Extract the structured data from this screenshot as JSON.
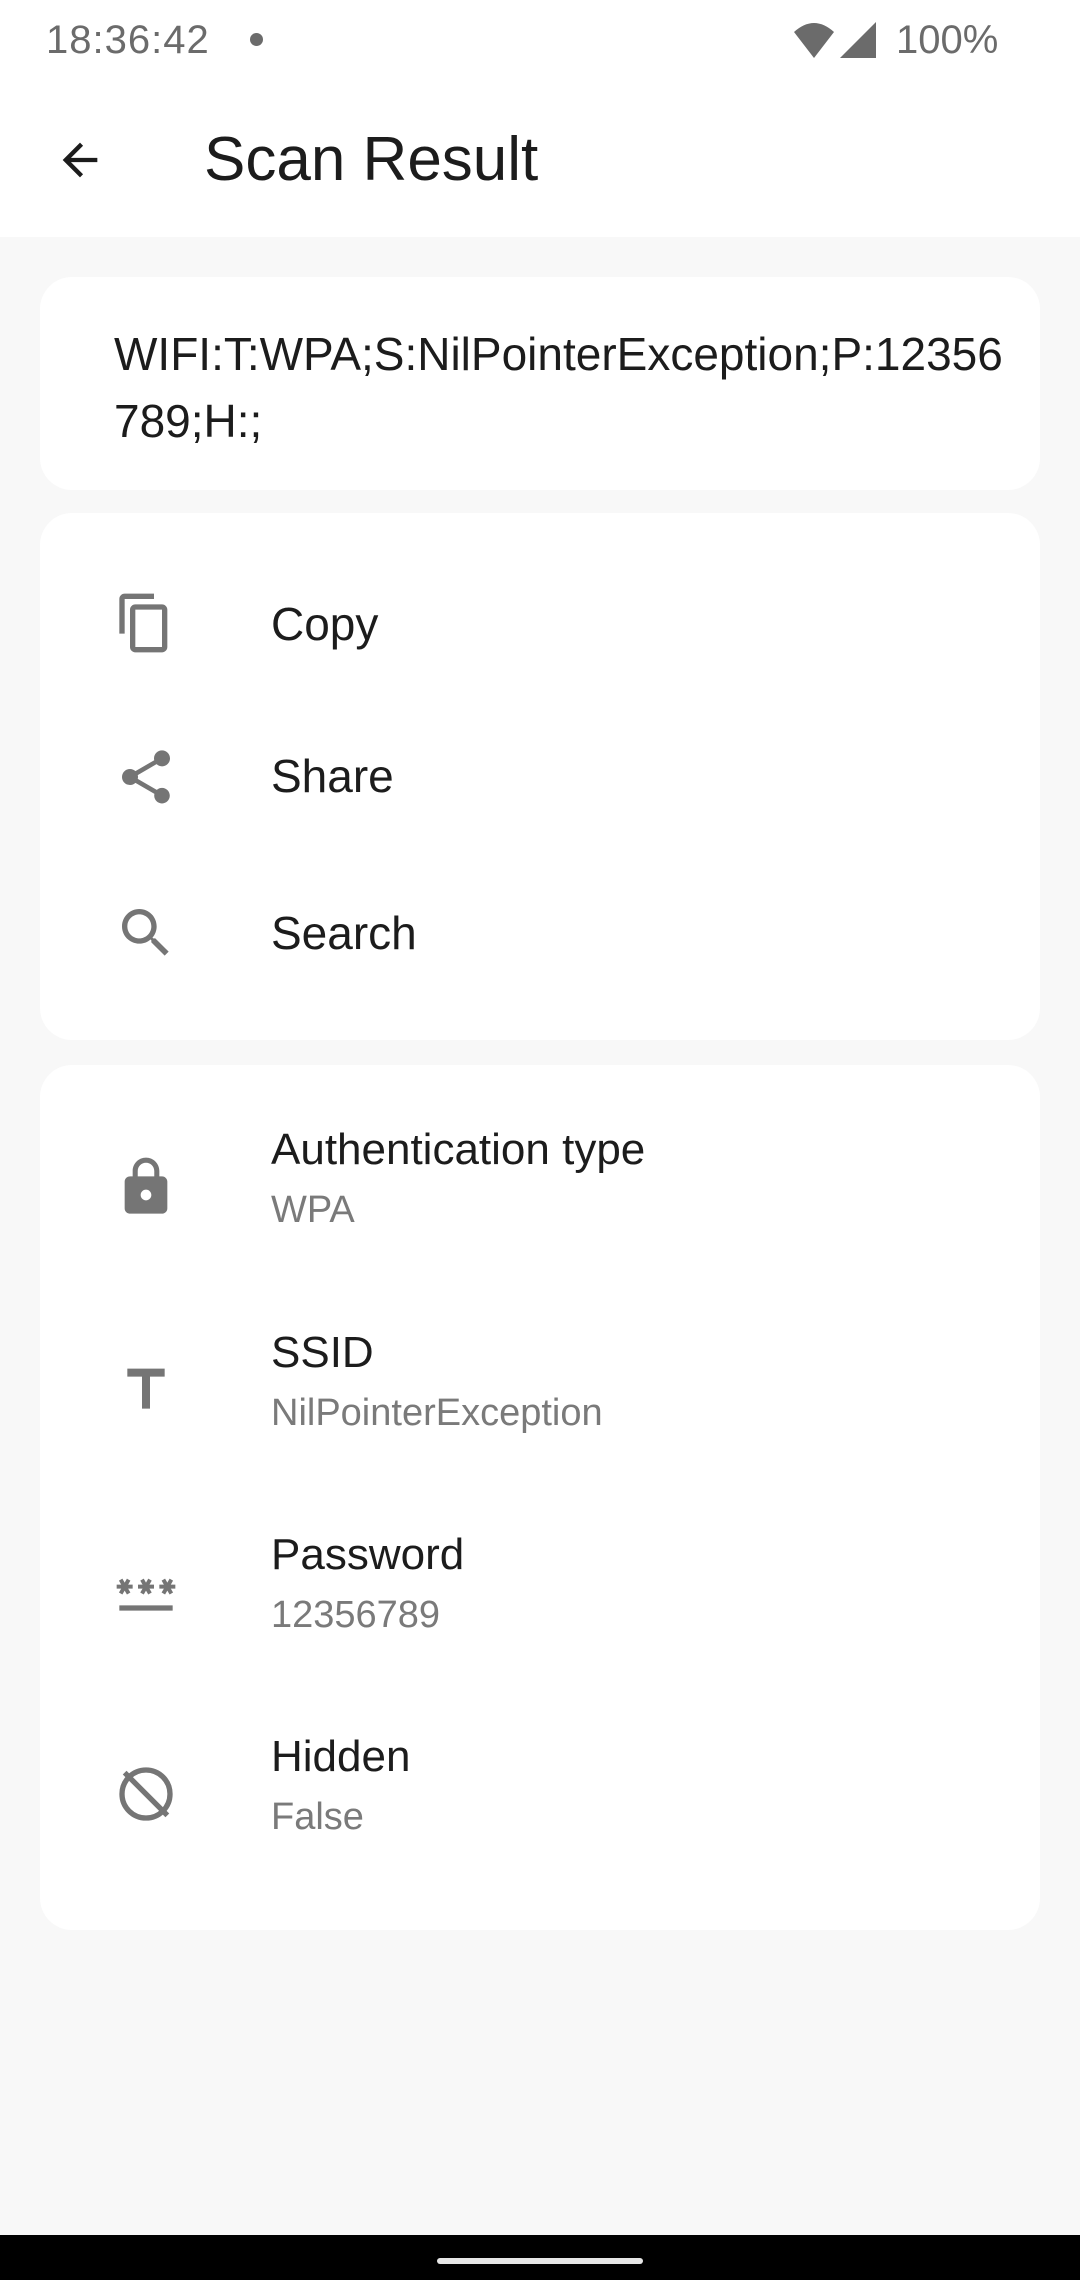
{
  "status_bar": {
    "time": "18:36:42",
    "battery": "100%"
  },
  "app_bar": {
    "title": "Scan Result",
    "back_icon": "arrow-back-icon"
  },
  "raw_result": {
    "text": "WIFI:T:WPA;S:NilPointerException;P:12356789;H:;"
  },
  "actions": [
    {
      "label": "Copy",
      "icon": "copy-icon"
    },
    {
      "label": "Share",
      "icon": "share-icon"
    },
    {
      "label": "Search",
      "icon": "search-icon"
    }
  ],
  "details": [
    {
      "title": "Authentication type",
      "value": "WPA",
      "icon": "lock-icon"
    },
    {
      "title": "SSID",
      "value": "NilPointerException",
      "icon": "text-icon"
    },
    {
      "title": "Password",
      "value": "12356789",
      "icon": "password-icon"
    },
    {
      "title": "Hidden",
      "value": "False",
      "icon": "hidden-off-icon"
    }
  ],
  "colors": {
    "background": "#f8f8f8",
    "card": "#ffffff",
    "primary_text": "#1c1c1c",
    "secondary_text": "#7a7a7a",
    "icon": "#757575"
  }
}
